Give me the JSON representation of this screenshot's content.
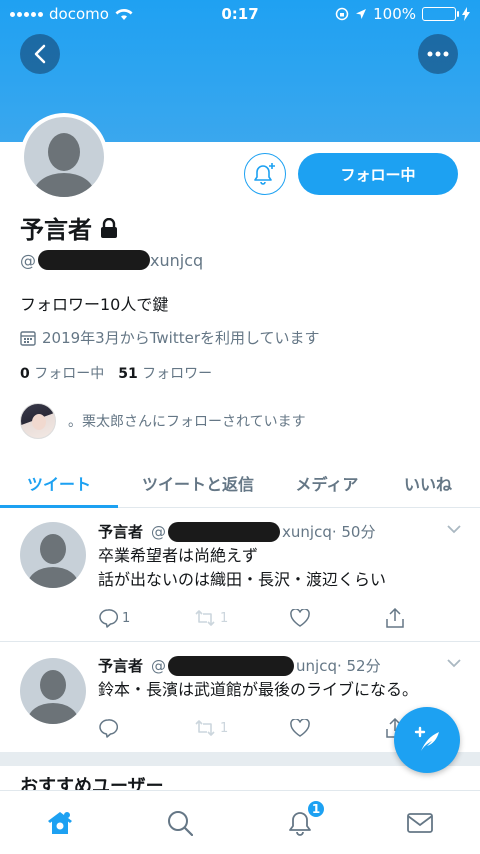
{
  "status_bar": {
    "carrier": "docomo",
    "time": "0:17",
    "battery": "100%"
  },
  "profile": {
    "display_name": "予言者",
    "handle_prefix": "@",
    "handle_suffix": "xunjcq",
    "bio": "フォロワー10人で鍵",
    "joined": "2019年3月からTwitterを利用しています",
    "following_count": "0",
    "following_label": "フォロー中",
    "followers_count": "51",
    "followers_label": "フォロワー",
    "followed_by": "。栗太郎さんにフォローされています",
    "follow_button": "フォロー中"
  },
  "tabs": [
    "ツイート",
    "ツイートと返信",
    "メディア",
    "いいね"
  ],
  "tweets": [
    {
      "name": "予言者",
      "handle_prefix": "@",
      "handle_suffix": "xunjcq",
      "time": "· 50分",
      "line1": "卒業希望者は尚絶えず",
      "line2": "話が出ないのは織田・長沢・渡辺くらい",
      "reply_count": "1",
      "retweet_count": "1"
    },
    {
      "name": "予言者",
      "handle_prefix": "@",
      "handle_suffix": "unjcq",
      "time": "· 52分",
      "line1": "鈴本・長濱は武道館が最後のライブになる。",
      "retweet_count": "1"
    }
  ],
  "suggest_partial": "おすすめユーザー",
  "bottom_nav": {
    "notifications_badge": "1"
  },
  "colors": {
    "accent": "#1da1f2",
    "banner": "#1fa1f2",
    "muted": "#657786"
  }
}
